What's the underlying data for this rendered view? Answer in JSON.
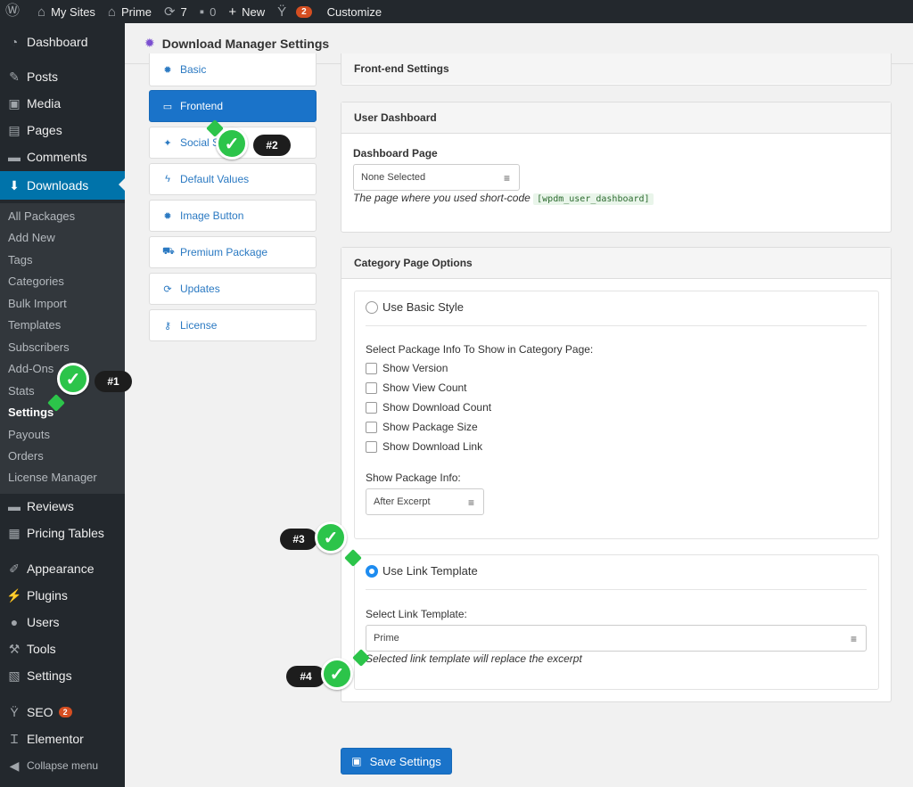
{
  "adminbar": {
    "my_sites": "My Sites",
    "site_name": "Prime",
    "updates_count": "7",
    "comments_count": "0",
    "new_label": "New",
    "seo_count": "2",
    "customize": "Customize"
  },
  "menu": {
    "dashboard": "Dashboard",
    "posts": "Posts",
    "media": "Media",
    "pages": "Pages",
    "comments": "Comments",
    "downloads": "Downloads",
    "submenu": [
      "All Packages",
      "Add New",
      "Tags",
      "Categories",
      "Bulk Import",
      "Templates",
      "Subscribers",
      "Add-Ons",
      "Stats",
      "Settings",
      "Payouts",
      "Orders",
      "License Manager"
    ],
    "reviews": "Reviews",
    "pricing_tables": "Pricing Tables",
    "appearance": "Appearance",
    "plugins": "Plugins",
    "users": "Users",
    "tools": "Tools",
    "settings": "Settings",
    "seo": "SEO",
    "seo_badge": "2",
    "elementor": "Elementor",
    "collapse": "Collapse menu"
  },
  "page": {
    "title": "Download Manager Settings"
  },
  "tabs": [
    "Basic",
    "Frontend",
    "Social S",
    "Default Values",
    "Image Button",
    "Premium Package",
    "Updates",
    "License"
  ],
  "frontend": {
    "section_title": "Front-end Settings"
  },
  "user_dashboard": {
    "title": "User Dashboard",
    "field_label": "Dashboard Page",
    "select_value": "None Selected",
    "help_text": "The page where you used short-code",
    "shortcode": "[wpdm_user_dashboard]"
  },
  "category_page": {
    "title": "Category Page Options",
    "basic_style": "Use Basic Style",
    "select_info_label": "Select Package Info To Show in Category Page:",
    "checkboxes": [
      "Show Version",
      "Show View Count",
      "Show Download Count",
      "Show Package Size",
      "Show Download Link"
    ],
    "show_info_label": "Show Package Info:",
    "show_info_value": "After Excerpt",
    "link_template": "Use Link Template",
    "select_template_label": "Select Link Template:",
    "template_value": "Prime",
    "template_help": "Selected link template will replace the excerpt"
  },
  "save_button": "Save Settings",
  "annotations": [
    "#1",
    "#2",
    "#3",
    "#4"
  ],
  "colors": {
    "admin_dark": "#23282d",
    "admin_blue": "#0073aa",
    "button_blue": "#1a73c9",
    "marker_green": "#2cc44a"
  }
}
